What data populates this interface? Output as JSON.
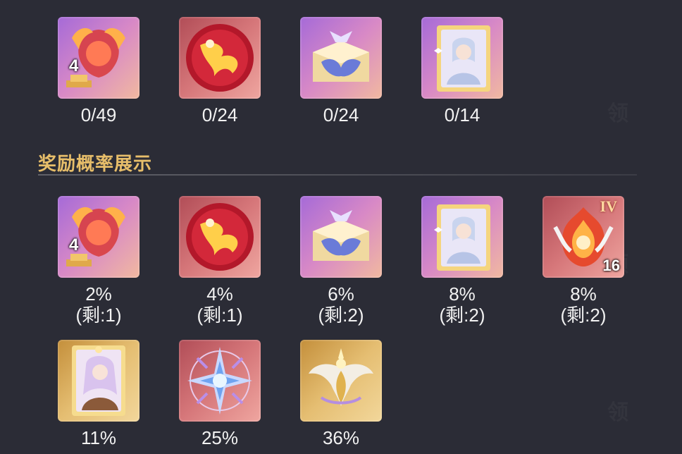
{
  "progress_items": [
    {
      "icon": "trophy-emblem-icon",
      "tier": "4",
      "count": "0/49"
    },
    {
      "icon": "red-orb-icon",
      "count": "0/24"
    },
    {
      "icon": "treasure-chest-icon",
      "count": "0/24"
    },
    {
      "icon": "character-card-icon",
      "count": "0/14"
    }
  ],
  "section": {
    "title": "奖励概率展示"
  },
  "rewards": [
    {
      "icon": "trophy-emblem-icon",
      "tier": "4",
      "rate": "2%",
      "remaining": "(剩:1)"
    },
    {
      "icon": "red-orb-icon",
      "rate": "4%",
      "remaining": "(剩:1)"
    },
    {
      "icon": "treasure-chest-icon",
      "rate": "6%",
      "remaining": "(剩:2)"
    },
    {
      "icon": "character-card-icon",
      "rate": "8%",
      "remaining": "(剩:2)"
    },
    {
      "icon": "flame-crest-icon",
      "roman": "IV",
      "quantity": "16",
      "rate": "8%",
      "remaining": "(剩:2)"
    },
    {
      "icon": "heroine-card-icon",
      "rate": "11%"
    },
    {
      "icon": "crystal-star-icon",
      "rate": "25%"
    },
    {
      "icon": "winged-emblem-icon",
      "rate": "36%"
    }
  ],
  "colors": {
    "accent_title": "#e7be6a",
    "background": "#2b2c36"
  }
}
